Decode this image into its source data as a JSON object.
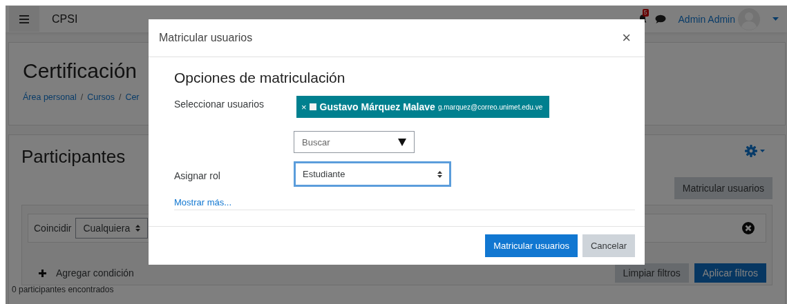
{
  "navbar": {
    "site_name": "CPSI",
    "notification_count": "5",
    "user_name": "Admin Admin"
  },
  "header": {
    "title": "Certificación",
    "breadcrumbs": [
      "Área personal",
      "Cursos",
      "Cer"
    ],
    "breadcrumb_separators": [
      "/",
      "/"
    ]
  },
  "participants": {
    "title": "Participantes",
    "enrol_button": "Matricular usuarios",
    "filter": {
      "match_label": "Coincidir",
      "match_value": "Cualquiera",
      "add_condition": "Agregar condición",
      "buttons": [
        {
          "label": "Limpiar filtros",
          "kind": "secondary"
        },
        {
          "label": "Aplicar filtros",
          "kind": "primary"
        }
      ]
    },
    "count_text": "0 participantes encontrados"
  },
  "modal": {
    "title": "Matricular usuarios",
    "close": "×",
    "section_title": "Opciones de matriculación",
    "select_users_label": "Seleccionar usuarios",
    "selected_users": [
      {
        "remove": "×",
        "name": "Gustavo Márquez Malave",
        "email": "g.marquez@correo.unimet.edu.ve"
      }
    ],
    "search": {
      "placeholder": "Buscar"
    },
    "role_label": "Asignar rol",
    "role": {
      "value": "Estudiante",
      "focused": true
    },
    "show_more": "Mostrar más...",
    "buttons": [
      {
        "label": "Matricular usuarios",
        "kind": "primary"
      },
      {
        "label": "Cancelar",
        "kind": "secondary"
      }
    ]
  }
}
